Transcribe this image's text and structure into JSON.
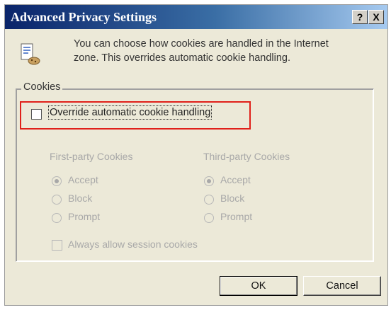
{
  "dialog": {
    "title": "Advanced Privacy Settings",
    "help_button": "?",
    "close_button": "X"
  },
  "description": {
    "line1": "You can choose how cookies are handled in the Internet",
    "line2": "zone.  This overrides automatic cookie handling."
  },
  "cookies_group": {
    "legend": "Cookies",
    "override_label": "Override automatic cookie handling",
    "override_checked": false,
    "first_party": {
      "heading": "First-party Cookies",
      "options": [
        "Accept",
        "Block",
        "Prompt"
      ],
      "selected": "Accept"
    },
    "third_party": {
      "heading": "Third-party Cookies",
      "options": [
        "Accept",
        "Block",
        "Prompt"
      ],
      "selected": "Accept"
    },
    "session_label": "Always allow session cookies",
    "session_checked": false
  },
  "buttons": {
    "ok": "OK",
    "cancel": "Cancel"
  },
  "colors": {
    "highlight": "#e0201a",
    "title_bar": "#0a246a"
  },
  "icons": {
    "cookie": "cookie-document-icon"
  }
}
